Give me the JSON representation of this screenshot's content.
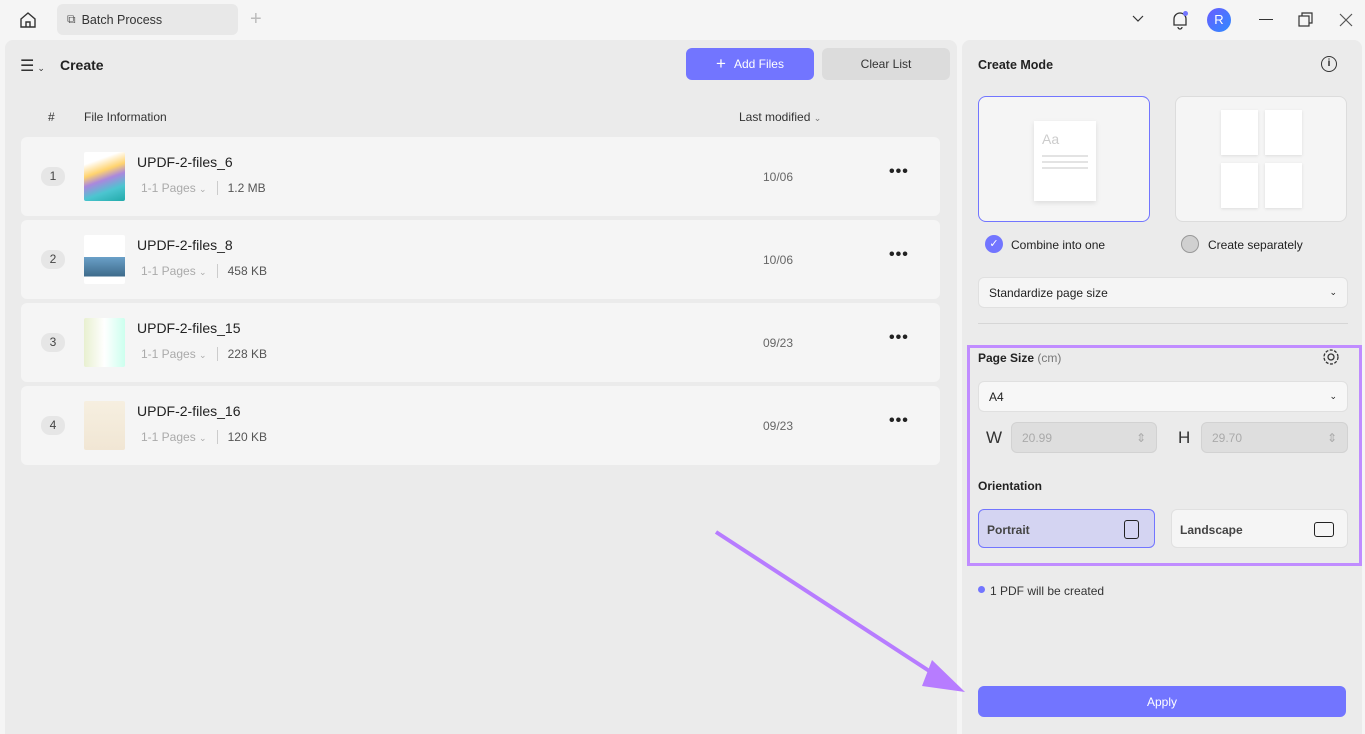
{
  "titlebar": {
    "tab_label": "Batch Process",
    "avatar_initial": "R"
  },
  "left": {
    "title": "Create",
    "add_files": "Add Files",
    "clear_list": "Clear List",
    "columns": {
      "index": "#",
      "file_info": "File Information",
      "last_modified": "Last modified"
    },
    "files": [
      {
        "index": "1",
        "name": "UPDF-2-files_6",
        "pages": "1-1 Pages",
        "size": "1.2 MB",
        "date": "10/06"
      },
      {
        "index": "2",
        "name": "UPDF-2-files_8",
        "pages": "1-1 Pages",
        "size": "458 KB",
        "date": "10/06"
      },
      {
        "index": "3",
        "name": "UPDF-2-files_15",
        "pages": "1-1 Pages",
        "size": "228 KB",
        "date": "09/23"
      },
      {
        "index": "4",
        "name": "UPDF-2-files_16",
        "pages": "1-1 Pages",
        "size": "120 KB",
        "date": "09/23"
      }
    ]
  },
  "right": {
    "create_mode": "Create Mode",
    "combine": "Combine into one",
    "separate": "Create separately",
    "standardize": "Standardize page size",
    "page_size_label": "Page Size",
    "page_size_unit": "(cm)",
    "page_size": "A4",
    "w_label": "W",
    "w_value": "20.99",
    "h_label": "H",
    "h_value": "29.70",
    "orientation": "Orientation",
    "portrait": "Portrait",
    "landscape": "Landscape",
    "status": "1 PDF will be created",
    "apply": "Apply"
  },
  "colors": {
    "accent": "#7275ff",
    "highlight": "#c08cff"
  }
}
